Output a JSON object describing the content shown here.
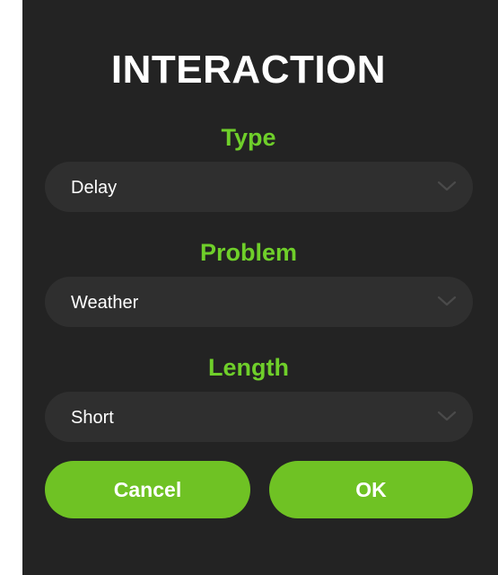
{
  "dialog": {
    "title": "INTERACTION",
    "fields": [
      {
        "label": "Type",
        "value": "Delay"
      },
      {
        "label": "Problem",
        "value": "Weather"
      },
      {
        "label": "Length",
        "value": "Short"
      }
    ],
    "buttons": {
      "cancel_label": "Cancel",
      "ok_label": "OK"
    }
  },
  "colors": {
    "background": "#232323",
    "accent": "#6fcf2a",
    "button": "#6fc224",
    "select_background": "#2f2f2f"
  },
  "icons": {
    "select_chevron": "chevron-down-icon"
  }
}
